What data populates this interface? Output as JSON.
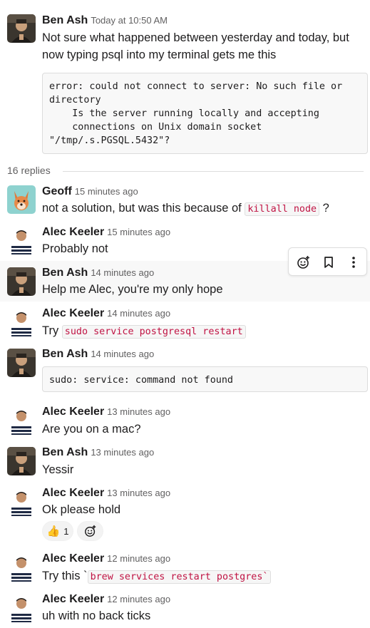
{
  "thread": {
    "root": {
      "author": "Ben Ash",
      "time": "Today at 10:50 AM",
      "text": "Not sure what happened between yesterday and today, but now typing psql into my terminal gets me this",
      "code": "error: could not connect to server: No such file or\ndirectory\n    Is the server running locally and accepting\n    connections on Unix domain socket\n\"/tmp/.s.PGSQL.5432\"?"
    },
    "replies_label": "16 replies",
    "replies": [
      {
        "author": "Geoff",
        "time": "15 minutes ago",
        "text_before": "not a solution, but was this because of ",
        "code": "killall node",
        "text_after": " ?"
      },
      {
        "author": "Alec Keeler",
        "time": "15 minutes ago",
        "text": "Probably not"
      },
      {
        "author": "Ben Ash",
        "time": "14 minutes ago",
        "text": "Help me Alec, you're my only hope"
      },
      {
        "author": "Alec Keeler",
        "time": "14 minutes ago",
        "text_before": "Try ",
        "code": "sudo service postgresql restart"
      },
      {
        "author": "Ben Ash",
        "time": "14 minutes ago",
        "code_block": "sudo: service: command not found"
      },
      {
        "author": "Alec Keeler",
        "time": "13 minutes ago",
        "text": "Are you on a mac?"
      },
      {
        "author": "Ben Ash",
        "time": "13 minutes ago",
        "text": "Yessir"
      },
      {
        "author": "Alec Keeler",
        "time": "13 minutes ago",
        "text": "Ok please hold",
        "reaction_emoji": "👍",
        "reaction_count": "1"
      },
      {
        "author": "Alec Keeler",
        "time": "12 minutes ago",
        "text_before": "Try this `",
        "code": "brew services restart postgres`"
      },
      {
        "author": "Alec Keeler",
        "time": "12 minutes ago",
        "text": "uh with no back ticks"
      }
    ]
  },
  "toolbar": {
    "icons": [
      "add-reaction-icon",
      "bookmark-icon",
      "more-actions-icon"
    ]
  },
  "colors": {
    "code_text": "#c01343",
    "timestamp": "#616061",
    "hover_bg": "#f8f8f8"
  }
}
